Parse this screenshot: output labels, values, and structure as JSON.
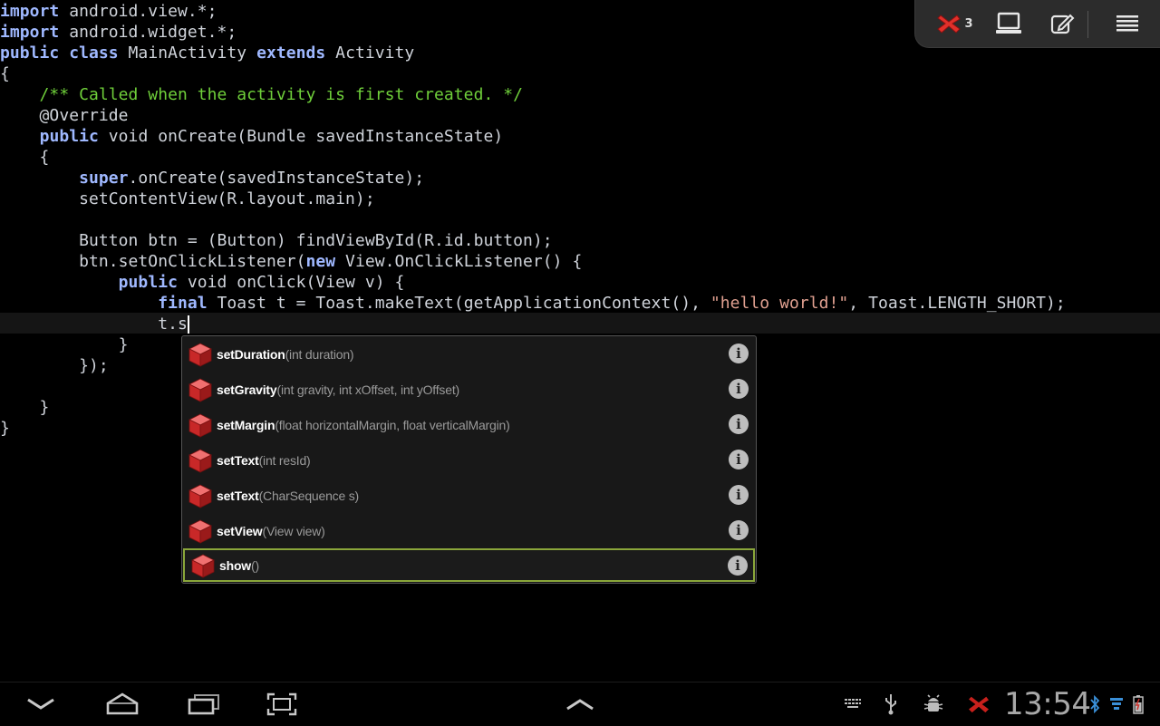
{
  "code_lines": [
    [
      {
        "t": "import",
        "c": "kw"
      },
      {
        "t": " android.view.*;",
        "c": "p"
      }
    ],
    [
      {
        "t": "import",
        "c": "kw"
      },
      {
        "t": " android.widget.*;",
        "c": "p"
      }
    ],
    [
      {
        "t": "public class",
        "c": "kw"
      },
      {
        "t": " MainActivity ",
        "c": "p"
      },
      {
        "t": "extends",
        "c": "kw"
      },
      {
        "t": " Activity",
        "c": "p"
      }
    ],
    [
      {
        "t": "{",
        "c": "p"
      }
    ],
    [
      {
        "t": "    /** Called when the activity is first created. */",
        "c": "cm"
      }
    ],
    [
      {
        "t": "    @Override",
        "c": "ann"
      }
    ],
    [
      {
        "t": "    ",
        "c": "p"
      },
      {
        "t": "public",
        "c": "kw"
      },
      {
        "t": " void onCreate(Bundle savedInstanceState)",
        "c": "p"
      }
    ],
    [
      {
        "t": "    {",
        "c": "p"
      }
    ],
    [
      {
        "t": "        ",
        "c": "p"
      },
      {
        "t": "super",
        "c": "kw"
      },
      {
        "t": ".onCreate(savedInstanceState);",
        "c": "p"
      }
    ],
    [
      {
        "t": "        setContentView(R.layout.main);",
        "c": "p"
      }
    ],
    [],
    [
      {
        "t": "        Button btn = (Button) findViewById(R.id.button);",
        "c": "p"
      }
    ],
    [
      {
        "t": "        btn.setOnClickListener(",
        "c": "p"
      },
      {
        "t": "new",
        "c": "kw"
      },
      {
        "t": " View.OnClickListener() {",
        "c": "p"
      }
    ],
    [
      {
        "t": "            ",
        "c": "p"
      },
      {
        "t": "public",
        "c": "kw"
      },
      {
        "t": " void onClick(View v) {",
        "c": "p"
      }
    ],
    [
      {
        "t": "                ",
        "c": "p"
      },
      {
        "t": "final",
        "c": "kw"
      },
      {
        "t": " Toast t = Toast.makeText(getApplicationContext(), ",
        "c": "p"
      },
      {
        "t": "\"hello world!\"",
        "c": "str"
      },
      {
        "t": ", Toast.LENGTH_SHORT);",
        "c": "p"
      }
    ],
    [
      {
        "t": "                t.s",
        "c": "p",
        "caret": true
      }
    ],
    [
      {
        "t": "            }",
        "c": "p"
      }
    ],
    [
      {
        "t": "        });",
        "c": "p"
      }
    ],
    [],
    [
      {
        "t": "    }",
        "c": "p"
      }
    ],
    [
      {
        "t": "}",
        "c": "p"
      }
    ]
  ],
  "toolbar": {
    "error_count": "3",
    "buttons": [
      "error-indicator",
      "laptop-icon",
      "edit-icon",
      "menu-icon"
    ]
  },
  "autocomplete": {
    "items": [
      {
        "name": "setDuration",
        "params": "(int duration)"
      },
      {
        "name": "setGravity",
        "params": "(int gravity, int xOffset, int yOffset)"
      },
      {
        "name": "setMargin",
        "params": "(float horizontalMargin, float verticalMargin)"
      },
      {
        "name": "setText",
        "params": "(int resId)"
      },
      {
        "name": "setText",
        "params": "(CharSequence s)"
      },
      {
        "name": "setView",
        "params": "(View view)"
      },
      {
        "name": "show",
        "params": "()",
        "selected": true
      }
    ],
    "info_glyph": "i"
  },
  "systembar": {
    "time": "13:54"
  },
  "colors": {
    "keyword": "#9fb8ff",
    "comment": "#6fcf3a",
    "string": "#e0a090",
    "selected_border": "#8aa63a",
    "error_red": "#d0302a"
  }
}
